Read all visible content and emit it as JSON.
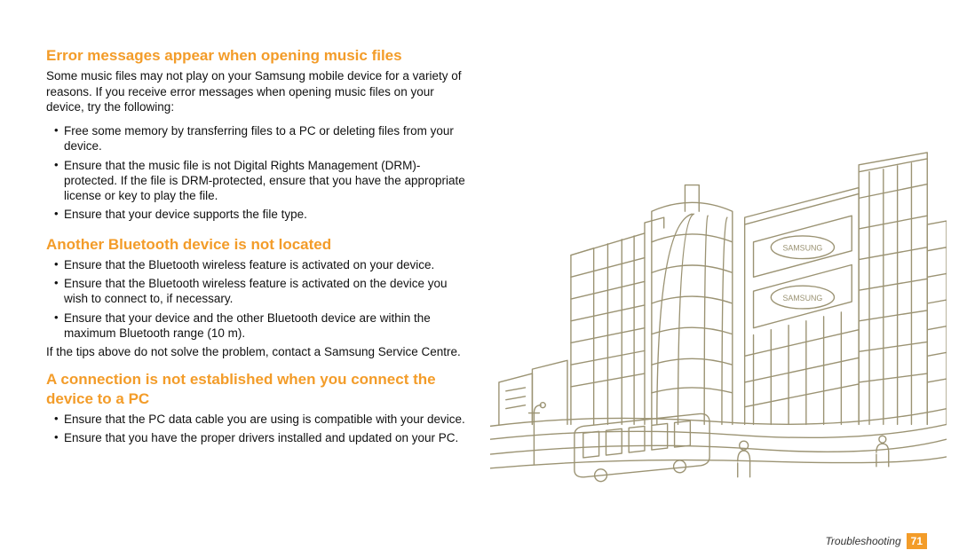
{
  "sections": [
    {
      "heading": "Error messages appear when opening music files",
      "intro": "Some music files may not play on your Samsung mobile device for a variety of reasons. If you receive error messages when opening music files on your device, try the following:",
      "bullets": [
        "Free some memory by transferring files to a PC or deleting files from your device.",
        "Ensure that the music file is not Digital Rights Management (DRM)-protected. If the file is DRM-protected, ensure that you have the appropriate license or key to play the file.",
        "Ensure that your device supports the file type."
      ]
    },
    {
      "heading": "Another Bluetooth device is not located",
      "bullets": [
        "Ensure that the Bluetooth wireless feature is activated on your device.",
        "Ensure that the Bluetooth wireless feature is activated on the device you wish to connect to, if necessary.",
        "Ensure that your device and the other Bluetooth device are within the maximum Bluetooth range (10 m)."
      ],
      "outro": "If the tips above do not solve the problem, contact a Samsung Service Centre."
    },
    {
      "heading": "A connection is not established when you connect the device to a PC",
      "bullets": [
        "Ensure that the PC data cable you are using is compatible with your device.",
        "Ensure that you have the proper drivers installed and updated on your PC."
      ]
    }
  ],
  "footer": {
    "section": "Troubleshooting",
    "page": "71"
  },
  "illustration_sign": "SAMSUNG"
}
